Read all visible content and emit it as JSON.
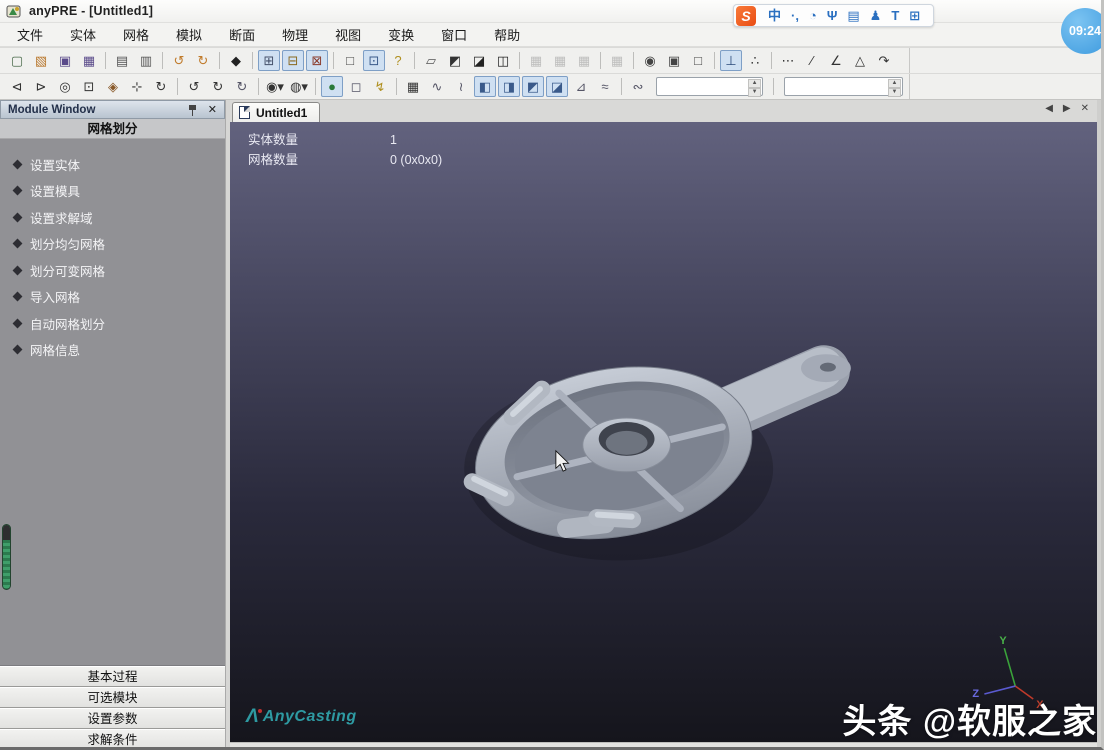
{
  "title_bar": {
    "title": "anyPRE - [Untitled1]"
  },
  "ime_bar": {
    "logo": "S",
    "icons": [
      {
        "n": "ime-chinese-mode-icon",
        "g": "中"
      },
      {
        "n": "ime-punctuation-icon",
        "g": "·,"
      },
      {
        "n": "ime-emoji-icon",
        "g": "◔"
      },
      {
        "n": "ime-mic-icon",
        "g": "Ψ"
      },
      {
        "n": "ime-handwriting-icon",
        "g": "▤"
      },
      {
        "n": "ime-account-icon",
        "g": "♟"
      },
      {
        "n": "ime-skin-icon",
        "g": "T"
      },
      {
        "n": "ime-toolbox-icon",
        "g": "⊞"
      }
    ]
  },
  "timer_badge": {
    "text": "09:24"
  },
  "menu_bar": {
    "items": [
      {
        "n": "menu-file",
        "label": "文件"
      },
      {
        "n": "menu-entity",
        "label": "实体"
      },
      {
        "n": "menu-mesh",
        "label": "网格"
      },
      {
        "n": "menu-simulation",
        "label": "模拟"
      },
      {
        "n": "menu-section",
        "label": "断面"
      },
      {
        "n": "menu-physics",
        "label": "物理"
      },
      {
        "n": "menu-view",
        "label": "视图"
      },
      {
        "n": "menu-transform",
        "label": "变换"
      },
      {
        "n": "menu-window",
        "label": "窗口"
      },
      {
        "n": "menu-help",
        "label": "帮助"
      }
    ]
  },
  "toolbar_row1": {
    "buttons": [
      {
        "n": "new-button",
        "g": "▢",
        "c": "#4a6a4a"
      },
      {
        "n": "open-button",
        "g": "▧",
        "c": "#b8762a"
      },
      {
        "n": "save-button",
        "g": "▣",
        "c": "#5a4a8a"
      },
      {
        "n": "save-all-button",
        "g": "▦",
        "c": "#5a4a8a"
      },
      {
        "sep": true
      },
      {
        "n": "print-button",
        "g": "▤",
        "c": "#555555"
      },
      {
        "n": "print-preview-button",
        "g": "▥",
        "c": "#555555"
      },
      {
        "sep": true
      },
      {
        "n": "undo-button",
        "g": "↺",
        "c": "#c07a2a"
      },
      {
        "n": "redo-button",
        "g": "↻",
        "c": "#c07a2a"
      },
      {
        "sep": true
      },
      {
        "n": "entity-mode-button",
        "g": "◆",
        "c": "#222222"
      },
      {
        "sep": true
      },
      {
        "n": "layout-single-button",
        "g": "⊞",
        "c": "#44506a",
        "sel": true
      },
      {
        "n": "layout-horizontal-button",
        "g": "⊟",
        "c": "#8a6a20",
        "sel": true
      },
      {
        "n": "layout-vertical-button",
        "g": "⊠",
        "c": "#8a3a2a",
        "sel": true
      },
      {
        "sep": true
      },
      {
        "n": "window-box-button",
        "g": "□",
        "c": "#444444"
      },
      {
        "n": "window-view-button",
        "g": "⊡",
        "c": "#3a5a8a",
        "sel": true
      },
      {
        "n": "context-help-button",
        "g": "?",
        "c": "#b09020"
      },
      {
        "sep": true
      },
      {
        "n": "copy-view-button",
        "g": "▱",
        "c": "#555555"
      },
      {
        "n": "select-entity-button",
        "g": "◩",
        "c": "#333333"
      },
      {
        "n": "select-box-button",
        "g": "◪",
        "c": "#222222"
      },
      {
        "n": "select-all-button",
        "g": "◫",
        "c": "#222222"
      },
      {
        "sep": true
      },
      {
        "n": "grid-table-1-button",
        "g": "▦",
        "c": "#808080",
        "dis": true
      },
      {
        "n": "grid-table-2-button",
        "g": "▦",
        "c": "#808080",
        "dis": true
      },
      {
        "n": "grid-table-3-button",
        "g": "▦",
        "c": "#808080",
        "dis": true
      },
      {
        "sep": true
      },
      {
        "n": "grid-table-4-button",
        "g": "▦",
        "c": "#808080",
        "dis": true
      },
      {
        "sep": true
      },
      {
        "n": "shape-circle-button",
        "g": "◉",
        "c": "#444444"
      },
      {
        "n": "shape-box-button",
        "g": "▣",
        "c": "#444444"
      },
      {
        "n": "shape-plane-button",
        "g": "□",
        "c": "#444444"
      },
      {
        "sep": true
      },
      {
        "n": "measure-stand-button",
        "g": "⊥",
        "c": "#2a4a7a",
        "sel": true
      },
      {
        "n": "measure-node-button",
        "g": "∴",
        "c": "#333333"
      },
      {
        "sep": true
      },
      {
        "n": "dim-point-button",
        "g": "⋯",
        "c": "#333333"
      },
      {
        "n": "dim-line-button",
        "g": "∕",
        "c": "#333333"
      },
      {
        "n": "dim-polyline-button",
        "g": "∠",
        "c": "#333333"
      },
      {
        "n": "dim-angle-button",
        "g": "△",
        "c": "#333333"
      },
      {
        "n": "dim-arc-button",
        "g": "↷",
        "c": "#333333"
      }
    ]
  },
  "toolbar_row2": {
    "buttons": [
      {
        "n": "zoom-prev-button",
        "g": "⊲",
        "c": "#333333"
      },
      {
        "n": "zoom-next-button",
        "g": "⊳",
        "c": "#333333"
      },
      {
        "n": "zoom-dynamic-button",
        "g": "◎",
        "c": "#333333"
      },
      {
        "n": "zoom-window-button",
        "g": "⊡",
        "c": "#333333"
      },
      {
        "n": "zoom-fit-button",
        "g": "◈",
        "c": "#8a5a2a"
      },
      {
        "n": "pan-button",
        "g": "⊹",
        "c": "#333333"
      },
      {
        "n": "rotate-view-button",
        "g": "↻",
        "c": "#333333"
      },
      {
        "sep": true
      },
      {
        "n": "rotate-x-button",
        "g": "↺",
        "c": "#333333"
      },
      {
        "n": "rotate-y-button",
        "g": "↻",
        "c": "#333333"
      },
      {
        "n": "rotate-z-button",
        "g": "↻",
        "c": "#555566"
      },
      {
        "sep": true
      },
      {
        "n": "view-direction-dropdown",
        "g": "◉▾",
        "c": "#333333"
      },
      {
        "n": "display-filter-dropdown",
        "g": "◍▾",
        "c": "#333333"
      },
      {
        "sep": true
      },
      {
        "n": "render-shaded-button",
        "g": "●",
        "c": "#2a7a3a",
        "sel": true
      },
      {
        "n": "render-wireframe-button",
        "g": "◻",
        "c": "#555566"
      },
      {
        "n": "render-flash-button",
        "g": "↯",
        "c": "#b09020"
      },
      {
        "sep": true
      },
      {
        "n": "mesh-tool-button",
        "g": "▦",
        "c": "#333333"
      },
      {
        "n": "curve-tool-button",
        "g": "∿",
        "c": "#555566"
      },
      {
        "n": "spline-tool-button",
        "g": "≀",
        "c": "#555566"
      },
      {
        "n": "view-front-button",
        "g": "◧",
        "c": "#3a5a8a",
        "sel": true
      },
      {
        "n": "view-back-button",
        "g": "◨",
        "c": "#3a5a8a",
        "sel": true
      },
      {
        "n": "view-left-button",
        "g": "◩",
        "c": "#3a5a8a",
        "sel": true
      },
      {
        "n": "view-right-button",
        "g": "◪",
        "c": "#3a5a8a",
        "sel": true
      },
      {
        "n": "view-iso-button",
        "g": "⊿",
        "c": "#555566"
      },
      {
        "n": "view-spin-button",
        "g": "≈",
        "c": "#555566"
      },
      {
        "sep": true
      },
      {
        "n": "section-tool-button",
        "g": "∾",
        "c": "#555566"
      }
    ],
    "fields": [
      {
        "n": "mesh-size-spinner",
        "value": ""
      },
      {
        "n": "mesh-count-spinner",
        "value": ""
      }
    ]
  },
  "module_window": {
    "title": "Module Window",
    "close_glyph": "✕",
    "section": "网格划分",
    "items": [
      {
        "n": "task-set-entity",
        "label": "设置实体"
      },
      {
        "n": "task-set-mold",
        "label": "设置模具"
      },
      {
        "n": "task-set-solution-domain",
        "label": "设置求解域"
      },
      {
        "n": "task-uniform-mesh",
        "label": "划分均匀网格"
      },
      {
        "n": "task-variable-mesh",
        "label": "划分可变网格"
      },
      {
        "n": "task-import-mesh",
        "label": "导入网格"
      },
      {
        "n": "task-auto-mesh",
        "label": "自动网格划分"
      },
      {
        "n": "task-mesh-info",
        "label": "网格信息"
      }
    ],
    "bottom_tabs": [
      {
        "n": "panel-tab-basic-process",
        "label": "基本过程"
      },
      {
        "n": "panel-tab-optional-module",
        "label": "可选模块"
      },
      {
        "n": "panel-tab-set-parameters",
        "label": "设置参数"
      },
      {
        "n": "panel-tab-solver-condition",
        "label": "求解条件"
      }
    ]
  },
  "doc_tabs": {
    "active": "Untitled1",
    "nav": {
      "prev": "◀",
      "next": "▶",
      "close": "✕"
    }
  },
  "viewport": {
    "stats": {
      "entity_label": "实体数量",
      "entity_value": "1",
      "mesh_label": "网格数量",
      "mesh_value": "0 (0x0x0)"
    },
    "logo_mark": "Λ",
    "logo_text": "AnyCasting",
    "axis": {
      "x": "X",
      "y": "Y",
      "z": "Z"
    }
  },
  "watermark": "头条 @软服之家",
  "colors": {
    "accent_blue": "#3f6fb4",
    "viewport_top": "#62627e",
    "viewport_bottom": "#15151c",
    "panel_gray": "#919195",
    "model_gray": "#b4bac4",
    "logo_teal": "#2e9aa2",
    "timer_blue": "#3d9ade",
    "sogou_orange": "#e94c14",
    "ime_icon_blue": "#2a6fc0"
  }
}
